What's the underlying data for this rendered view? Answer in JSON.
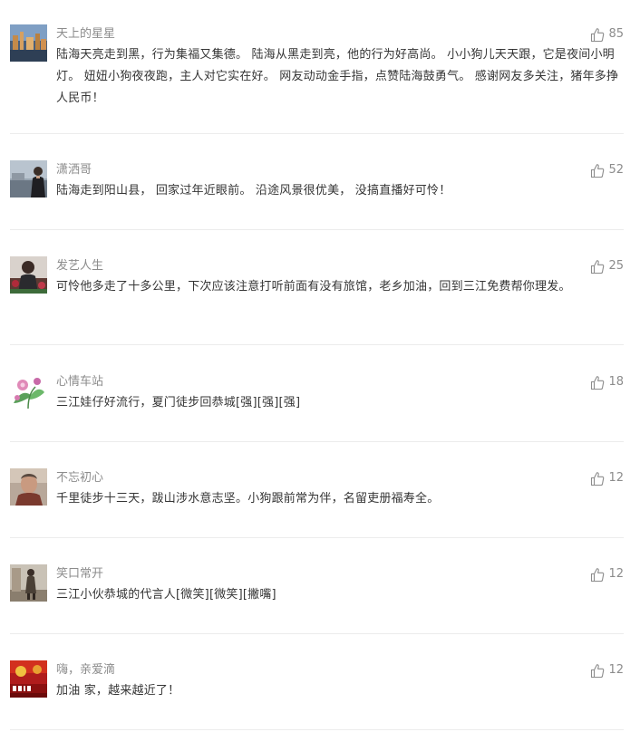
{
  "comments": [
    {
      "user": "天上的星星",
      "likes": "85",
      "text": "陆海天亮走到黑，行为集福又集德。 陆海从黑走到亮，他的行为好高尚。 小小狗儿天天跟，它是夜间小明灯。 妞妞小狗夜夜跑，主人对它实在好。 网友动动金手指，点赞陆海鼓勇气。 感谢网友多关注，猪年多挣人民币！"
    },
    {
      "user": "潇洒哥",
      "likes": "52",
      "text": "陆海走到阳山县， 回家过年近眼前。 沿途风景很优美， 没搞直播好可怜！"
    },
    {
      "user": "发艺人生",
      "likes": "25",
      "text": "可怜他多走了十多公里，下次应该注意打听前面有没有旅馆，老乡加油，回到三江免费帮你理发。"
    },
    {
      "user": "心情车站",
      "likes": "18",
      "text": "三江娃仔好流行，夏门徒步回恭城[强][强][强]"
    },
    {
      "user": "不忘初心",
      "likes": "12",
      "text": "千里徒步十三天，跋山涉水意志坚。小狗跟前常为伴，名留吏册福寿全。"
    },
    {
      "user": "笑口常开",
      "likes": "12",
      "text": "三江小伙恭城的代言人[微笑][微笑][撇嘴]"
    },
    {
      "user": "嗨，亲爱滴",
      "likes": "12",
      "text": "加油 家，越来越近了！"
    }
  ]
}
